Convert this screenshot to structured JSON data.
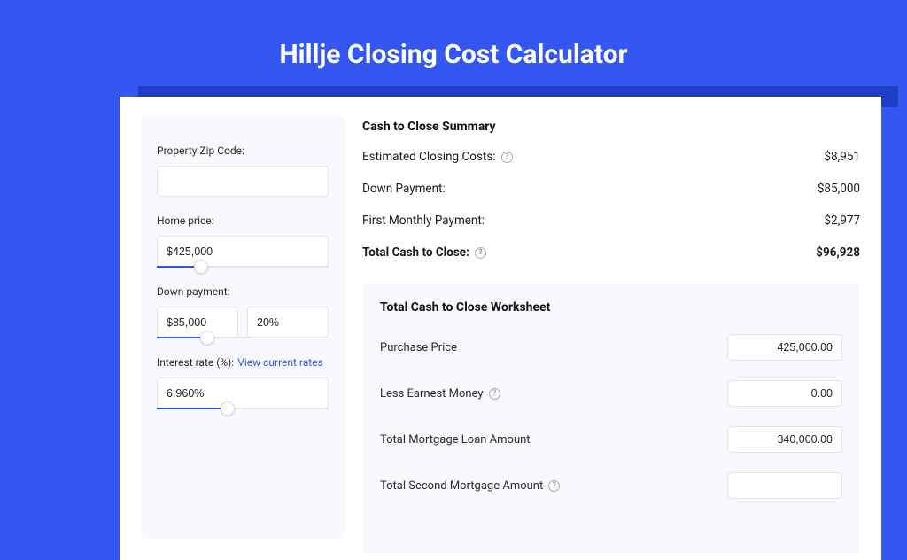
{
  "title": "Hillje Closing Cost Calculator",
  "form": {
    "zip": {
      "label": "Property Zip Code:",
      "value": ""
    },
    "home_price": {
      "label": "Home price:",
      "value": "$425,000",
      "slider_pct": 26
    },
    "down_payment": {
      "label": "Down payment:",
      "value": "$85,000",
      "pct": "20%",
      "slider_pct": 29
    },
    "interest": {
      "label": "Interest rate (%):",
      "link": "View current rates",
      "value": "6.960%",
      "slider_pct": 41
    }
  },
  "summary": {
    "heading": "Cash to Close Summary",
    "rows": [
      {
        "label": "Estimated Closing Costs:",
        "help": true,
        "value": "$8,951"
      },
      {
        "label": "Down Payment:",
        "help": false,
        "value": "$85,000"
      },
      {
        "label": "First Monthly Payment:",
        "help": false,
        "value": "$2,977"
      }
    ],
    "total": {
      "label": "Total Cash to Close:",
      "help": true,
      "value": "$96,928"
    }
  },
  "worksheet": {
    "heading": "Total Cash to Close Worksheet",
    "rows": [
      {
        "label": "Purchase Price",
        "help": false,
        "value": "425,000.00"
      },
      {
        "label": "Less Earnest Money",
        "help": true,
        "value": "0.00"
      },
      {
        "label": "Total Mortgage Loan Amount",
        "help": false,
        "value": "340,000.00"
      },
      {
        "label": "Total Second Mortgage Amount",
        "help": true,
        "value": ""
      }
    ]
  }
}
